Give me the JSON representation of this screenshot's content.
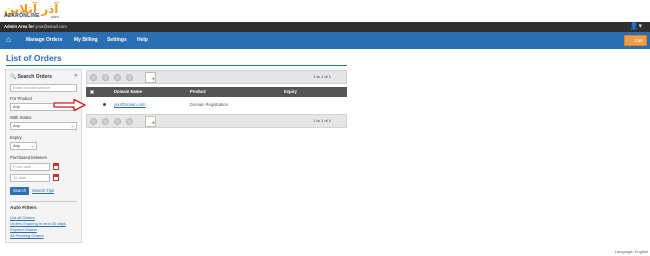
{
  "logo": {
    "brand": "آذر آنلاین",
    "sub": "AZARONLINE",
    "domain": ".com"
  },
  "topbar": {
    "admin_prefix": "Admin Area for",
    "admin_email": "your@email.com"
  },
  "nav": {
    "items": [
      "Manage Orders",
      "My Billing",
      "Settings",
      "Help"
    ],
    "cart_label": "Cart"
  },
  "page": {
    "title": "List of Orders"
  },
  "sidebar": {
    "heading": "Search Orders",
    "search_placeholder": "Enter domain search",
    "for_product_label": "For Product",
    "for_product_value": "Any",
    "with_status_label": "With Status",
    "with_status_value": "Any",
    "expiry_label": "Expiry",
    "expiry_value": "Any",
    "purchased_label": "Purchased between",
    "date_from_placeholder": "From date",
    "date_to_placeholder": "To date",
    "search_button": "Search",
    "search_tips": "Search Tips"
  },
  "auto_filters": {
    "heading": "Auto Filters",
    "links": [
      "List all Orders",
      "Orders Expiring in next 30 days",
      "Expired Orders",
      "All Pending Orders"
    ]
  },
  "toolbar": {
    "pagination": "1 to 1 of 1"
  },
  "table": {
    "columns": [
      "Domain Name",
      "Product",
      "Expiry"
    ],
    "rows": [
      {
        "domain": "yourDomain.com",
        "product": "Domain Registration",
        "expiry": ""
      }
    ]
  },
  "footer": {
    "language": "Language: English"
  },
  "colors": {
    "primary": "#2a6fb3",
    "accent": "#f0a043",
    "arrow": "#d11f1f"
  }
}
